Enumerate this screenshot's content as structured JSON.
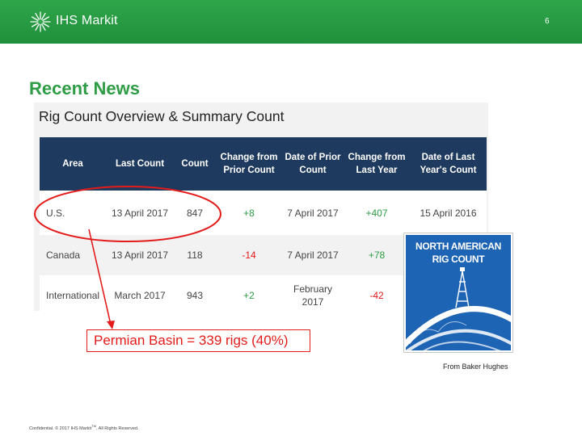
{
  "header": {
    "brand": "IHS Markit",
    "page_number": "6"
  },
  "title": "Recent News",
  "panel": {
    "title": "Rig Count Overview & Summary Count",
    "columns": [
      "Area",
      "Last Count",
      "Count",
      "Change from Prior Count",
      "Date of Prior Count",
      "Change from Last Year",
      "Date of Last Year's Count"
    ],
    "rows": [
      {
        "area": "U.S.",
        "last_count": "13 April 2017",
        "count": "847",
        "change_prior": "+8",
        "date_prior": "7 April 2017",
        "change_year": "+407",
        "date_last_year": "15 April 2016"
      },
      {
        "area": "Canada",
        "last_count": "13 April 2017",
        "count": "118",
        "change_prior": "-14",
        "date_prior": "7 April 2017",
        "change_year": "+78",
        "date_last_year": ""
      },
      {
        "area": "International",
        "last_count": "March 2017",
        "count": "943",
        "change_prior": "+2",
        "date_prior": "February 2017",
        "change_year": "-42",
        "date_last_year": ""
      }
    ]
  },
  "callout": "Permian Basin = 339 rigs (40%)",
  "badge": {
    "line1": "NORTH AMERICAN",
    "line2": "RIG COUNT"
  },
  "credit": "From Baker Hughes",
  "footer": {
    "text": "Confidential. © 2017 IHS Markit",
    "tm": "TM",
    "suffix": ". All Rights Reserved."
  },
  "colors": {
    "green": "#2e9c45",
    "navy": "#1f3a5f",
    "red": "#e31b1b",
    "badge_blue": "#1e64b4"
  }
}
